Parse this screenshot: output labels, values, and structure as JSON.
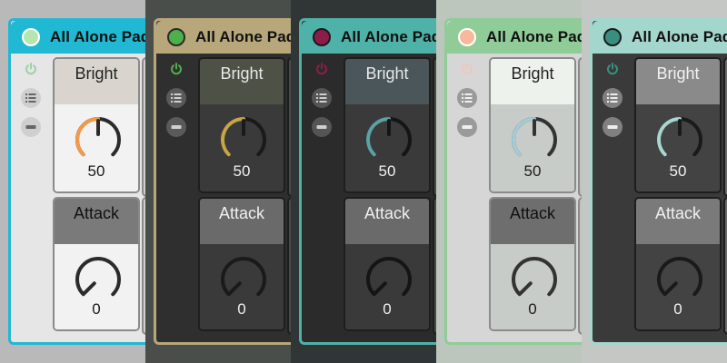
{
  "device_title": "All Alone Pad",
  "macros": [
    {
      "label": "Bright",
      "value": "50",
      "level": 0.5
    },
    {
      "label": "Attack",
      "value": "0",
      "level": 0.0
    }
  ],
  "icons": [
    "power-icon",
    "list-icon",
    "minimize-icon"
  ],
  "themes": [
    {
      "name": "light-blue",
      "bg": "#b9b9b9",
      "frame": "#21b8d3",
      "title_bar": "#21b8d3",
      "title_text": "#101010",
      "activator": "#b6e6b0",
      "activator_ring": "#ffffff",
      "body": "#e6e6e6",
      "btn_bg": "#cfcfcf",
      "btn_fg": "#666666",
      "power_fg": "#9fd2a5",
      "macro_head": "#d9d5ce",
      "macro_text": "#222222",
      "macro_body": "#f2f2f2",
      "macro_head2": "#7a7a7a",
      "knob_track": "#2b2b2b",
      "knob_arc": "#f29a4a",
      "val_text": "#1a1a1a",
      "peek": "#d0d0d0"
    },
    {
      "name": "dark-tan",
      "bg": "#4a4e4a",
      "frame": "#b8a77a",
      "title_bar": "#b8a77a",
      "title_text": "#101010",
      "activator": "#4db04a",
      "activator_ring": "#2a2a2a",
      "body": "#2f2f2f",
      "btn_bg": "#5a5a5a",
      "btn_fg": "#cfcfcf",
      "power_fg": "#4db04a",
      "macro_head": "#4d5146",
      "macro_text": "#e8e8e8",
      "macro_body": "#3a3a3a",
      "macro_head2": "#6a6a6a",
      "knob_track": "#1a1a1a",
      "knob_arc": "#c8a545",
      "val_text": "#f0f0f0",
      "peek": "#4a4a4a"
    },
    {
      "name": "dark-teal",
      "bg": "#303536",
      "frame": "#4fb2a8",
      "title_bar": "#4fb2a8",
      "title_text": "#101010",
      "activator": "#8c1d48",
      "activator_ring": "#1a1a1a",
      "body": "#2b2b2b",
      "btn_bg": "#555555",
      "btn_fg": "#cfcfcf",
      "power_fg": "#8c1d48",
      "macro_head": "#4a5659",
      "macro_text": "#e8e8e8",
      "macro_body": "#3a3a3a",
      "macro_head2": "#6a6a6a",
      "knob_track": "#151515",
      "knob_arc": "#5ba1a6",
      "val_text": "#f0f0f0",
      "peek": "#4a4a4a"
    },
    {
      "name": "sage",
      "bg": "#bcc6bc",
      "frame": "#8fcc98",
      "title_bar": "#8fcc98",
      "title_text": "#101010",
      "activator": "#f7b89c",
      "activator_ring": "#ffffff",
      "body": "#d6d6d6",
      "btn_bg": "#9a9a9a",
      "btn_fg": "#f0f0f0",
      "power_fg": "#f2c6b8",
      "macro_head": "#eef2ec",
      "macro_text": "#222222",
      "macro_body": "#c8ccc8",
      "macro_head2": "#6e6e6e",
      "knob_track": "#333333",
      "knob_arc": "#a5cbd6",
      "val_text": "#1a1a1a",
      "peek": "#c0c4c0"
    },
    {
      "name": "grey-mint",
      "bg": "#c5c7c5",
      "frame": "#a3d6cc",
      "title_bar": "#a3d6cc",
      "title_text": "#101010",
      "activator": "#3a8e80",
      "activator_ring": "#1a1a1a",
      "body": "#3a3a3a",
      "btn_bg": "#808080",
      "btn_fg": "#ededed",
      "power_fg": "#3a8e80",
      "macro_head": "#8a8a8a",
      "macro_text": "#f2f2f2",
      "macro_body": "#434343",
      "macro_head2": "#7a7a7a",
      "knob_track": "#1a1a1a",
      "knob_arc": "#a8d6d0",
      "val_text": "#f2f2f2",
      "peek": "#6a6a6a"
    }
  ]
}
